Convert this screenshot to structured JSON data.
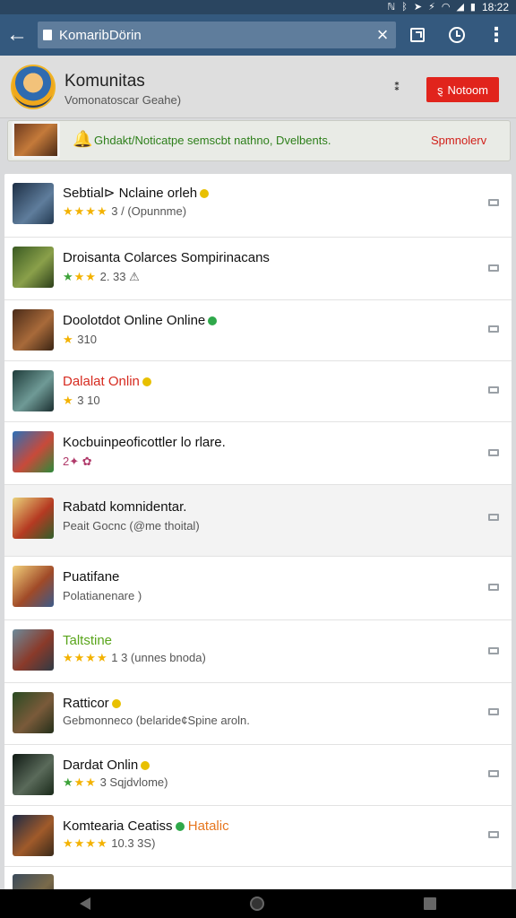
{
  "status_bar": {
    "time": "18:22"
  },
  "toolbar": {
    "url": "KomaribDörin"
  },
  "community": {
    "title": "Komunitas",
    "subtitle": "Vomonatoscar Geahe)",
    "sort_glyph": "⁑",
    "button_label": "Notoom",
    "button_prefix": "ȿ"
  },
  "banner": {
    "text": "Ghdakt/Noticatpe semscbt nathno, Dvelbents.",
    "link": "Spmnolerv"
  },
  "games": [
    {
      "title": "Sebtial⊳ Nclaine orleh",
      "badge": "yellow",
      "title_color": "default",
      "stars": "★★★★",
      "sub": "3 / (Opunnme)"
    },
    {
      "title": "Droisanta Colarces Sompirinacans",
      "badge": "",
      "title_color": "default",
      "stars": "★★★",
      "sub": "2. 33 ⚠"
    },
    {
      "title": "Doolotdot Online Online",
      "badge": "green",
      "title_color": "default",
      "stars": "★",
      "sub": "310"
    },
    {
      "title": "Dalalat Onlin",
      "badge": "yellow",
      "title_color": "red",
      "stars": "★",
      "sub": "3 10"
    },
    {
      "title": "Kocbuinpeoficottler lo rlare.",
      "badge": "",
      "title_color": "default",
      "stars": "",
      "sub": "2✦ ✿"
    },
    {
      "title": "Rabatd komnidentar.",
      "badge": "",
      "title_color": "default",
      "stars": "",
      "sub": "Peait Gocnc (@me thoital)"
    },
    {
      "title": "Puatifane",
      "badge": "",
      "title_color": "default",
      "stars": "",
      "sub": "Polatianenare )"
    },
    {
      "title": "Taltstine",
      "badge": "",
      "title_color": "green",
      "stars": "★★★★",
      "sub": "1 3 (unnes bnoda)"
    },
    {
      "title": "Ratticor",
      "badge": "yellow",
      "title_color": "default",
      "stars": "",
      "sub": "Gebmonneco (belaride¢Spine aroln."
    },
    {
      "title": "Dardat Onlin",
      "badge": "yellow",
      "title_color": "default",
      "stars": "★★★",
      "sub": "3 Sqjdvlome)"
    },
    {
      "title": "Komtearia Ceatiss",
      "badge": "green",
      "title_color": "default",
      "extra": "Hatalic",
      "stars": "★★★★",
      "sub": "10.3 3S)"
    }
  ],
  "colors": {
    "toolbar": "#34597e",
    "accent_button": "#e1241c",
    "star": "#f3b200"
  },
  "icons": [
    "back-arrow-icon",
    "lock-icon",
    "clear-icon",
    "open-external-icon",
    "history-icon",
    "overflow-menu-icon",
    "bell-icon",
    "row-menu-icon",
    "nav-back-icon",
    "nav-home-icon",
    "nav-recents-icon"
  ]
}
